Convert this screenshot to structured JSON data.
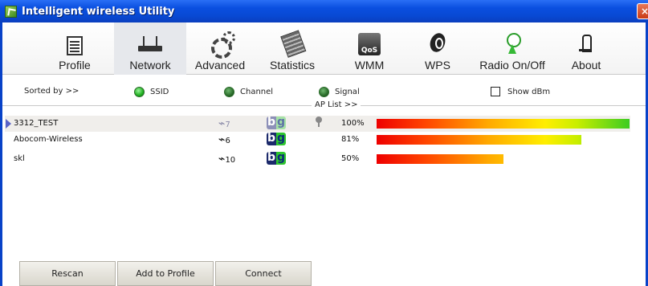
{
  "window": {
    "title": "Intelligent wireless Utility",
    "close_glyph": "×"
  },
  "toolbar": {
    "items": [
      {
        "label": "Profile",
        "icon": "profile-icon",
        "active": false
      },
      {
        "label": "Network",
        "icon": "network-icon",
        "active": true
      },
      {
        "label": "Advanced",
        "icon": "advanced-icon",
        "active": false
      },
      {
        "label": "Statistics",
        "icon": "statistics-icon",
        "active": false
      },
      {
        "label": "WMM",
        "icon": "wmm-icon",
        "active": false
      },
      {
        "label": "WPS",
        "icon": "wps-icon",
        "active": false
      },
      {
        "label": "Radio On/Off",
        "icon": "radio-icon",
        "active": false
      },
      {
        "label": "About",
        "icon": "about-icon",
        "active": false
      }
    ]
  },
  "sort": {
    "label": "Sorted by >>",
    "options": [
      {
        "label": "SSID",
        "selected": true
      },
      {
        "label": "Channel",
        "selected": false
      },
      {
        "label": "Signal",
        "selected": false
      }
    ],
    "show_dbm": {
      "label": "Show dBm",
      "checked": false
    }
  },
  "ap_list": {
    "label": "AP List >>",
    "rows": [
      {
        "ssid": "3312_TEST",
        "channel": "7",
        "modes": [
          "b",
          "g"
        ],
        "secured": true,
        "signal": "100%",
        "signal_fraction": 1.0,
        "selected": true
      },
      {
        "ssid": "Abocom-Wireless",
        "channel": "6",
        "modes": [
          "b",
          "g"
        ],
        "secured": false,
        "signal": "81%",
        "signal_fraction": 0.81,
        "selected": false
      },
      {
        "ssid": "skl",
        "channel": "10",
        "modes": [
          "b",
          "g"
        ],
        "secured": false,
        "signal": "50%",
        "signal_fraction": 0.5,
        "selected": false
      }
    ]
  },
  "buttons": {
    "rescan": "Rescan",
    "add_to_profile": "Add to Profile",
    "connect": "Connect"
  },
  "colors": {
    "titlebar": "#0a4fe0",
    "selected_row": "#f0eeeb",
    "bar_low": "#ee0000",
    "bar_high": "#3ccc22"
  }
}
